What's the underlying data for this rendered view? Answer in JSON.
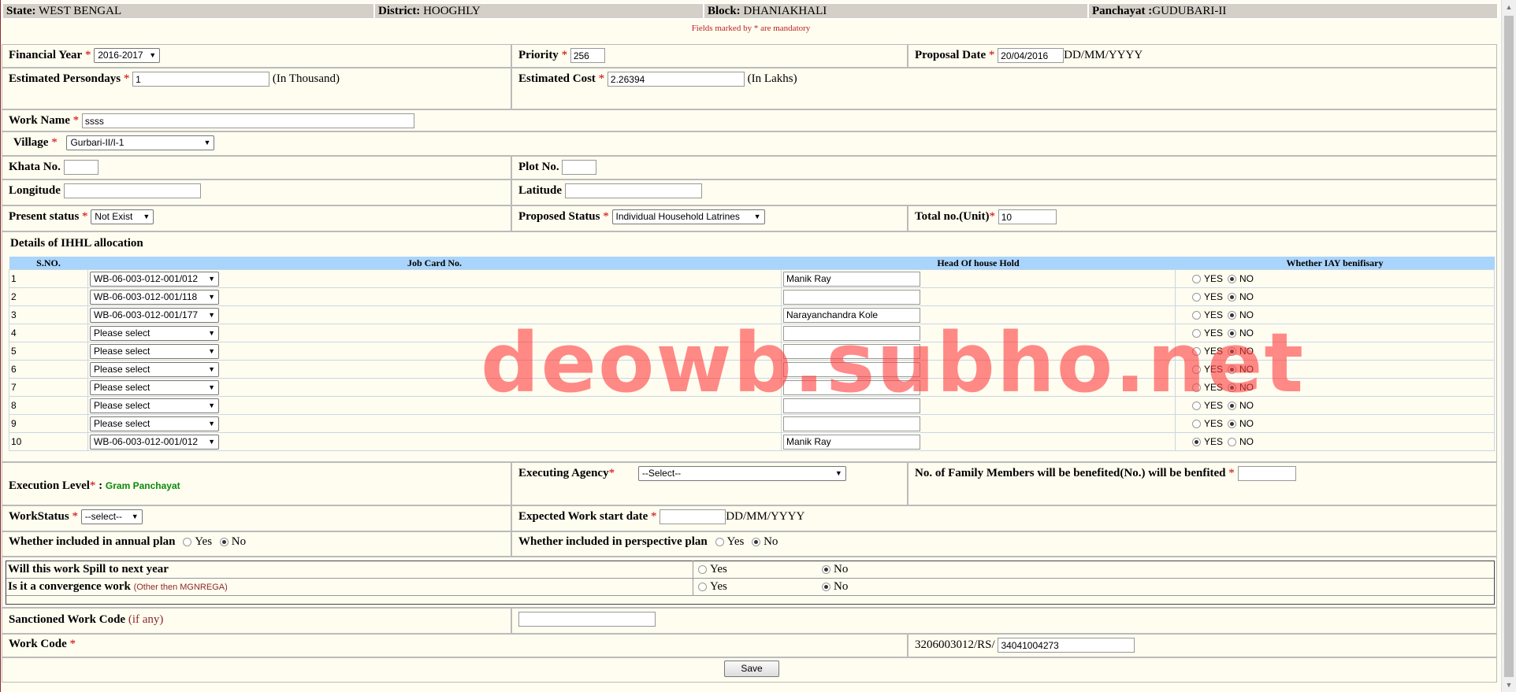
{
  "header": {
    "state_label": "State:",
    "state": "WEST BENGAL",
    "district_label": "District:",
    "district": "HOOGHLY",
    "block_label": "Block:",
    "block": "DHANIAKHALI",
    "panchayat_label": "Panchayat :",
    "panchayat": "GUDUBARI-II"
  },
  "mandatory_note": "Fields marked by * are mandatory",
  "form": {
    "financial_year_label": "Financial Year",
    "financial_year": "2016-2017",
    "priority_label": "Priority",
    "priority": "256",
    "proposal_date_label": "Proposal Date",
    "proposal_date": "20/04/2016",
    "date_fmt": "DD/MM/YYYY",
    "persondays_label": "Estimated Persondays",
    "persondays": "1",
    "persondays_unit": "(In Thousand)",
    "cost_label": "Estimated Cost",
    "cost": "2.26394",
    "cost_unit": "(In Lakhs)",
    "work_name_label": "Work Name",
    "work_name": "ssss",
    "village_label": "Village",
    "village": "Gurbari-II/I-1",
    "khata_label": "Khata No.",
    "plot_label": "Plot No.",
    "longitude_label": "Longitude",
    "latitude_label": "Latitude",
    "present_status_label": "Present status",
    "present_status": "Not Exist",
    "proposed_status_label": "Proposed Status",
    "proposed_status": "Individual Household Latrines",
    "total_units_label": "Total no.(Unit)",
    "total_units": "10",
    "star": "*"
  },
  "ihhl": {
    "title": "Details of IHHL allocation",
    "headers": [
      "S.NO.",
      "Job Card No.",
      "Head Of house Hold",
      "Whether IAY benifisary"
    ],
    "yes": "YES",
    "no": "NO",
    "rows": [
      {
        "sno": "1",
        "job": "WB-06-003-012-001/012",
        "head": "Manik Ray",
        "iay": "no"
      },
      {
        "sno": "2",
        "job": "WB-06-003-012-001/118",
        "head": "",
        "iay": "no"
      },
      {
        "sno": "3",
        "job": "WB-06-003-012-001/177",
        "head": "Narayanchandra Kole",
        "iay": "no"
      },
      {
        "sno": "4",
        "job": "Please select",
        "head": "",
        "iay": "no"
      },
      {
        "sno": "5",
        "job": "Please select",
        "head": "",
        "iay": "no"
      },
      {
        "sno": "6",
        "job": "Please select",
        "head": "",
        "iay": "no"
      },
      {
        "sno": "7",
        "job": "Please select",
        "head": "",
        "iay": "no"
      },
      {
        "sno": "8",
        "job": "Please select",
        "head": "",
        "iay": "no"
      },
      {
        "sno": "9",
        "job": "Please select",
        "head": "",
        "iay": "no"
      },
      {
        "sno": "10",
        "job": "WB-06-003-012-001/012",
        "head": "Manik Ray",
        "iay": "yes"
      }
    ]
  },
  "exec": {
    "level_label": "Execution Level",
    "level": "Gram Panchayat",
    "agency_label": "Executing Agency",
    "agency": "--Select--",
    "family_label": "No. of Family Members will be benefited(No.) will be benfited",
    "work_status_label": "WorkStatus",
    "work_status": "--select--",
    "start_date_label": "Expected Work start date",
    "annual_label": "Whether included in annual plan",
    "perspective_label": "Whether included in perspective plan",
    "yes": "Yes",
    "no": "No",
    "spill_label": "Will this work Spill to next year",
    "convergence_label": "Is it a convergence work",
    "convergence_sub": "(Other then MGNREGA)",
    "sanctioned_label": "Sanctioned Work Code",
    "sanctioned_sub": "(if any)",
    "work_code_label": "Work Code",
    "work_code_prefix": "3206003012/RS/",
    "work_code": "34041004273",
    "save": "Save"
  },
  "watermark": "deowb.subho.net"
}
